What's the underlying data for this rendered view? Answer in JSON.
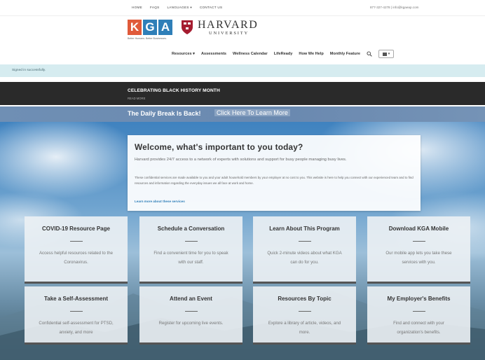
{
  "util": {
    "links": [
      "HOME",
      "FAQS",
      "LANGUAGES ▾",
      "CONTACT US"
    ],
    "contact": "877-327-4278 | info@kgaeap.com"
  },
  "logo": {
    "letters": [
      "K",
      "G",
      "A"
    ],
    "tagline": "Better Humans. Better Businesses.",
    "harvard_main": "HARVARD",
    "harvard_sub": "UNIVERSITY"
  },
  "nav": {
    "items": [
      "Resources ▾",
      "Assessments",
      "Wellness Calendar",
      "LifeReady",
      "How We Help",
      "Monthly Feature"
    ],
    "search_icon": "search-icon",
    "user_label": "▾"
  },
  "alerts": {
    "signed_in": "Signed in successfully."
  },
  "announcement": {
    "title": "CELEBRATING BLACK HISTORY MONTH",
    "link": "READ MORE"
  },
  "daily_break": {
    "text": "The Daily Break Is Back!",
    "link": "Click Here To Learn More"
  },
  "welcome": {
    "title": "Welcome, what's important to you today?",
    "intro": "Harvard provides 24/7 access to a network of experts with solutions and support for busy people managing busy lives.",
    "detail": "These confidential services are made available to you and your adult household members by your employer at no cost to you. This website is here to help you connect with our experienced team and to find resources and information regarding the everyday issues we all face at work and home.",
    "link": "Learn more about these services"
  },
  "tiles": [
    {
      "title": "COVID-19 Resource Page",
      "desc": "Access helpful resources related to the Coronavirus."
    },
    {
      "title": "Schedule a Conversation",
      "desc": "Find a convenient time for you to speak with our staff."
    },
    {
      "title": "Learn About This Program",
      "desc": "Quick 2-minute videos about what KGA can do for you."
    },
    {
      "title": "Download KGA Mobile",
      "desc": "Our mobile app lets you take these services with you."
    },
    {
      "title": "Take a Self-Assessment",
      "desc": "Confidential self-assessment for PTSD, anxiety, and more"
    },
    {
      "title": "Attend an Event",
      "desc": "Register for upcoming live events."
    },
    {
      "title": "Resources By Topic",
      "desc": "Explore a library of article, videos, and more."
    },
    {
      "title": "My Employer's Benefits",
      "desc": "Find and connect with your organization's benefits."
    }
  ],
  "colors": {
    "kga_orange": "#e05a3a",
    "kga_blue": "#2f7fb8",
    "banner_dark": "#2a2a2a",
    "banner_blue": "#6f8fb4",
    "alert_bg": "#d6ecf0"
  }
}
